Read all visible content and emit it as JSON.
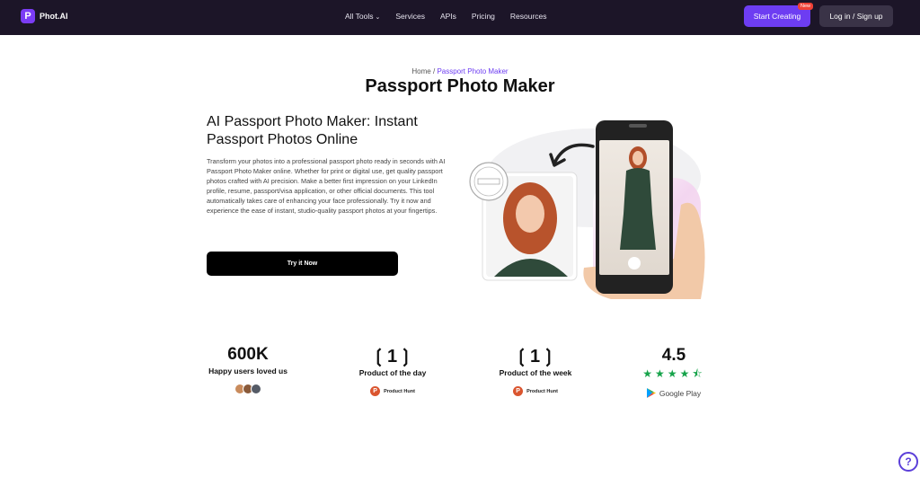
{
  "nav": {
    "logo_letter": "P",
    "logo_text": "Phot.AI",
    "links": [
      {
        "label": "All Tools",
        "chevron": "⌄"
      },
      {
        "label": "Services"
      },
      {
        "label": "APIs"
      },
      {
        "label": "Pricing"
      },
      {
        "label": "Resources"
      }
    ],
    "start_label": "Start Creating",
    "new_badge": "New",
    "login_label": "Log in / Sign up"
  },
  "breadcrumb": {
    "home": "Home",
    "sep": "/",
    "current": "Passport Photo Maker"
  },
  "page_title": "Passport Photo Maker",
  "hero": {
    "heading": "AI Passport Photo Maker: Instant Passport Photos Online",
    "description": "Transform your photos into a professional passport photo ready in seconds with AI Passport Photo Maker online. Whether for print or digital use, get quality passport photos crafted with AI precision. Make a better first impression on your LinkedIn profile, resume, passport/visa application, or other official documents. This tool automatically takes care of enhancing your face professionally. Try it now and experience the ease of instant, studio-quality passport photos at your fingertips.",
    "cta": "Try it Now"
  },
  "stats": {
    "users_count": "600K",
    "users_label": "Happy users loved us",
    "day_rank": "1",
    "day_label": "Product of the day",
    "day_source": "Product Hunt",
    "week_rank": "1",
    "week_label": "Product of the week",
    "week_source": "Product Hunt",
    "rating": "4.5",
    "stars": "★★★★⯪",
    "rating_source": "Google Play"
  },
  "help_icon": "?",
  "colors": {
    "nav_bg": "#1c1528",
    "accent": "#6d3df2",
    "cta_bg": "#000000",
    "star": "#16a34a"
  }
}
